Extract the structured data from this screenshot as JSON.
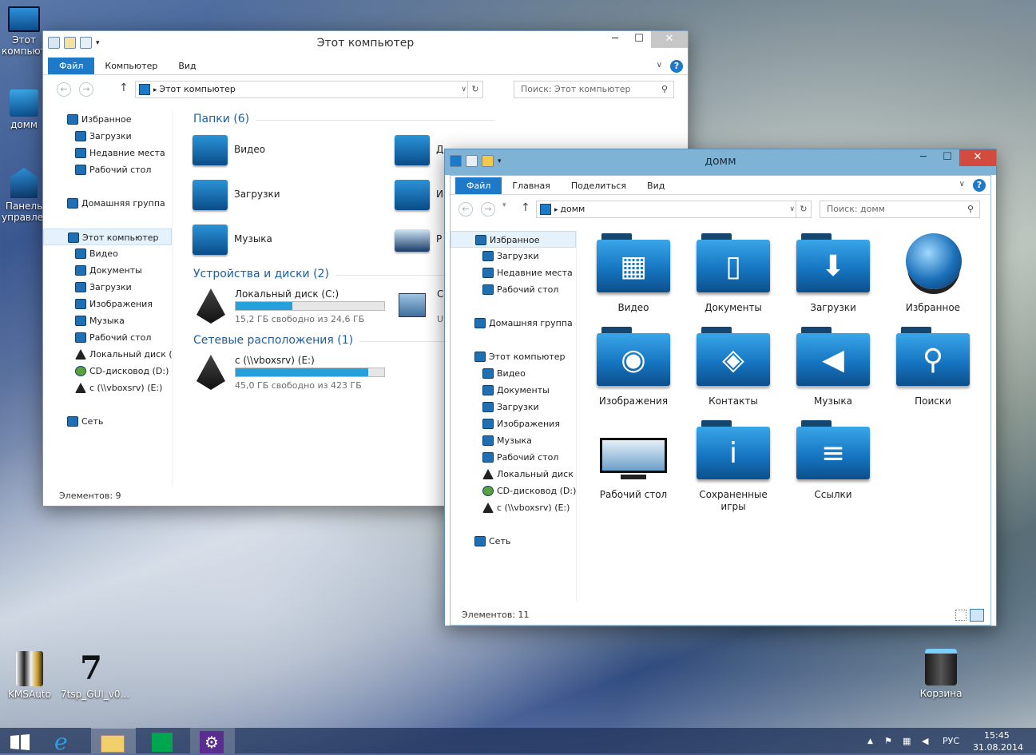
{
  "desktop_icons": [
    {
      "label": "Этот компьютер",
      "icon": "computer-icon"
    },
    {
      "label": "домм",
      "icon": "user-folder-icon"
    },
    {
      "label": "Панель управления",
      "icon": "control-panel-icon"
    },
    {
      "label": "KMSAuto",
      "icon": "kmsauto-icon"
    },
    {
      "label": "7tsp_GUI_v0...",
      "icon": "7tsp-icon"
    },
    {
      "label": "Корзина",
      "icon": "recycle-bin-icon"
    }
  ],
  "win1": {
    "title": "Этот компьютер",
    "tabs": [
      "Файл",
      "Компьютер",
      "Вид"
    ],
    "address": "Этот компьютер",
    "search_placeholder": "Поиск: Этот компьютер",
    "nav": [
      {
        "label": "Избранное",
        "icon": "star-icon"
      },
      {
        "label": "Загрузки",
        "icon": "downloads-icon"
      },
      {
        "label": "Недавние места",
        "icon": "recent-icon"
      },
      {
        "label": "Рабочий стол",
        "icon": "desktop-icon"
      },
      {
        "label": "Домашняя группа",
        "icon": "homegroup-icon"
      },
      {
        "label": "Этот компьютер",
        "icon": "computer-icon"
      },
      {
        "label": "Видео",
        "icon": "video-icon"
      },
      {
        "label": "Документы",
        "icon": "documents-icon"
      },
      {
        "label": "Загрузки",
        "icon": "downloads-icon"
      },
      {
        "label": "Изображения",
        "icon": "pictures-icon"
      },
      {
        "label": "Музыка",
        "icon": "music-icon"
      },
      {
        "label": "Рабочий стол",
        "icon": "desktop-icon"
      },
      {
        "label": "Локальный диск (C",
        "icon": "disk-icon"
      },
      {
        "label": "CD-дисковод (D:) D",
        "icon": "cd-icon"
      },
      {
        "label": "c (\\\\vboxsrv) (E:)",
        "icon": "netdrive-icon"
      },
      {
        "label": "Сеть",
        "icon": "network-icon"
      }
    ],
    "group_folders": "Папки (6)",
    "folders": [
      {
        "label": "Видео",
        "icon": "video-icon"
      },
      {
        "label": "Загрузки",
        "icon": "downloads-icon"
      },
      {
        "label": "Музыка",
        "icon": "music-icon"
      },
      {
        "label": "Д",
        "icon": "documents-icon"
      },
      {
        "label": "И",
        "icon": "pictures-icon"
      },
      {
        "label": "Р",
        "icon": "desktop-icon"
      }
    ],
    "group_devices": "Устройства и диски (2)",
    "drives": [
      {
        "name": "Локальный диск (C:)",
        "free": "15,2 ГБ свободно из 24,6 ГБ",
        "used": 0.38
      },
      {
        "name": "CI",
        "free": "U",
        "used": 0
      }
    ],
    "group_network": "Сетевые расположения (1)",
    "netdrives": [
      {
        "name": "c (\\\\vboxsrv) (E:)",
        "free": "45,0 ГБ свободно из 423 ГБ",
        "used": 0.89
      }
    ],
    "status": "Элементов: 9"
  },
  "win2": {
    "title": "домм",
    "tabs": [
      "Файл",
      "Главная",
      "Поделиться",
      "Вид"
    ],
    "address": "домм",
    "search_placeholder": "Поиск: домм",
    "nav": [
      {
        "label": "Избранное",
        "icon": "star-icon"
      },
      {
        "label": "Загрузки",
        "icon": "downloads-icon"
      },
      {
        "label": "Недавние места",
        "icon": "recent-icon"
      },
      {
        "label": "Рабочий стол",
        "icon": "desktop-icon"
      },
      {
        "label": "Домашняя группа",
        "icon": "homegroup-icon"
      },
      {
        "label": "Этот компьютер",
        "icon": "computer-icon"
      },
      {
        "label": "Видео",
        "icon": "video-icon"
      },
      {
        "label": "Документы",
        "icon": "documents-icon"
      },
      {
        "label": "Загрузки",
        "icon": "downloads-icon"
      },
      {
        "label": "Изображения",
        "icon": "pictures-icon"
      },
      {
        "label": "Музыка",
        "icon": "music-icon"
      },
      {
        "label": "Рабочий стол",
        "icon": "desktop-icon"
      },
      {
        "label": "Локальный диск (C",
        "icon": "disk-icon"
      },
      {
        "label": "CD-дисковод (D:) D",
        "icon": "cd-icon"
      },
      {
        "label": "c (\\\\vboxsrv) (E:)",
        "icon": "netdrive-icon"
      },
      {
        "label": "Сеть",
        "icon": "network-icon"
      }
    ],
    "items": [
      {
        "label": "Видео",
        "icon": "video-folder-icon",
        "sym": "▦"
      },
      {
        "label": "Документы",
        "icon": "documents-folder-icon",
        "sym": "▯"
      },
      {
        "label": "Загрузки",
        "icon": "downloads-folder-icon",
        "sym": "⬇"
      },
      {
        "label": "Избранное",
        "icon": "favorites-orb-icon",
        "sym": "●"
      },
      {
        "label": "Изображения",
        "icon": "pictures-folder-icon",
        "sym": "◉"
      },
      {
        "label": "Контакты",
        "icon": "contacts-folder-icon",
        "sym": "◈"
      },
      {
        "label": "Музыка",
        "icon": "music-folder-icon",
        "sym": "◀"
      },
      {
        "label": "Поиски",
        "icon": "search-folder-icon",
        "sym": "⚲"
      },
      {
        "label": "Рабочий стол",
        "icon": "desktop-monitor-icon",
        "sym": ""
      },
      {
        "label": "Сохраненные игры",
        "icon": "saved-games-folder-icon",
        "sym": "i"
      },
      {
        "label": "Ссылки",
        "icon": "links-folder-icon",
        "sym": "≡"
      }
    ],
    "status": "Элементов: 11"
  },
  "taskbar": {
    "items": [
      "start-icon",
      "ie-icon",
      "explorer-icon",
      "store-icon",
      "settings-icon"
    ],
    "lang": "РУС",
    "time": "15:45",
    "date": "31.08.2014"
  }
}
